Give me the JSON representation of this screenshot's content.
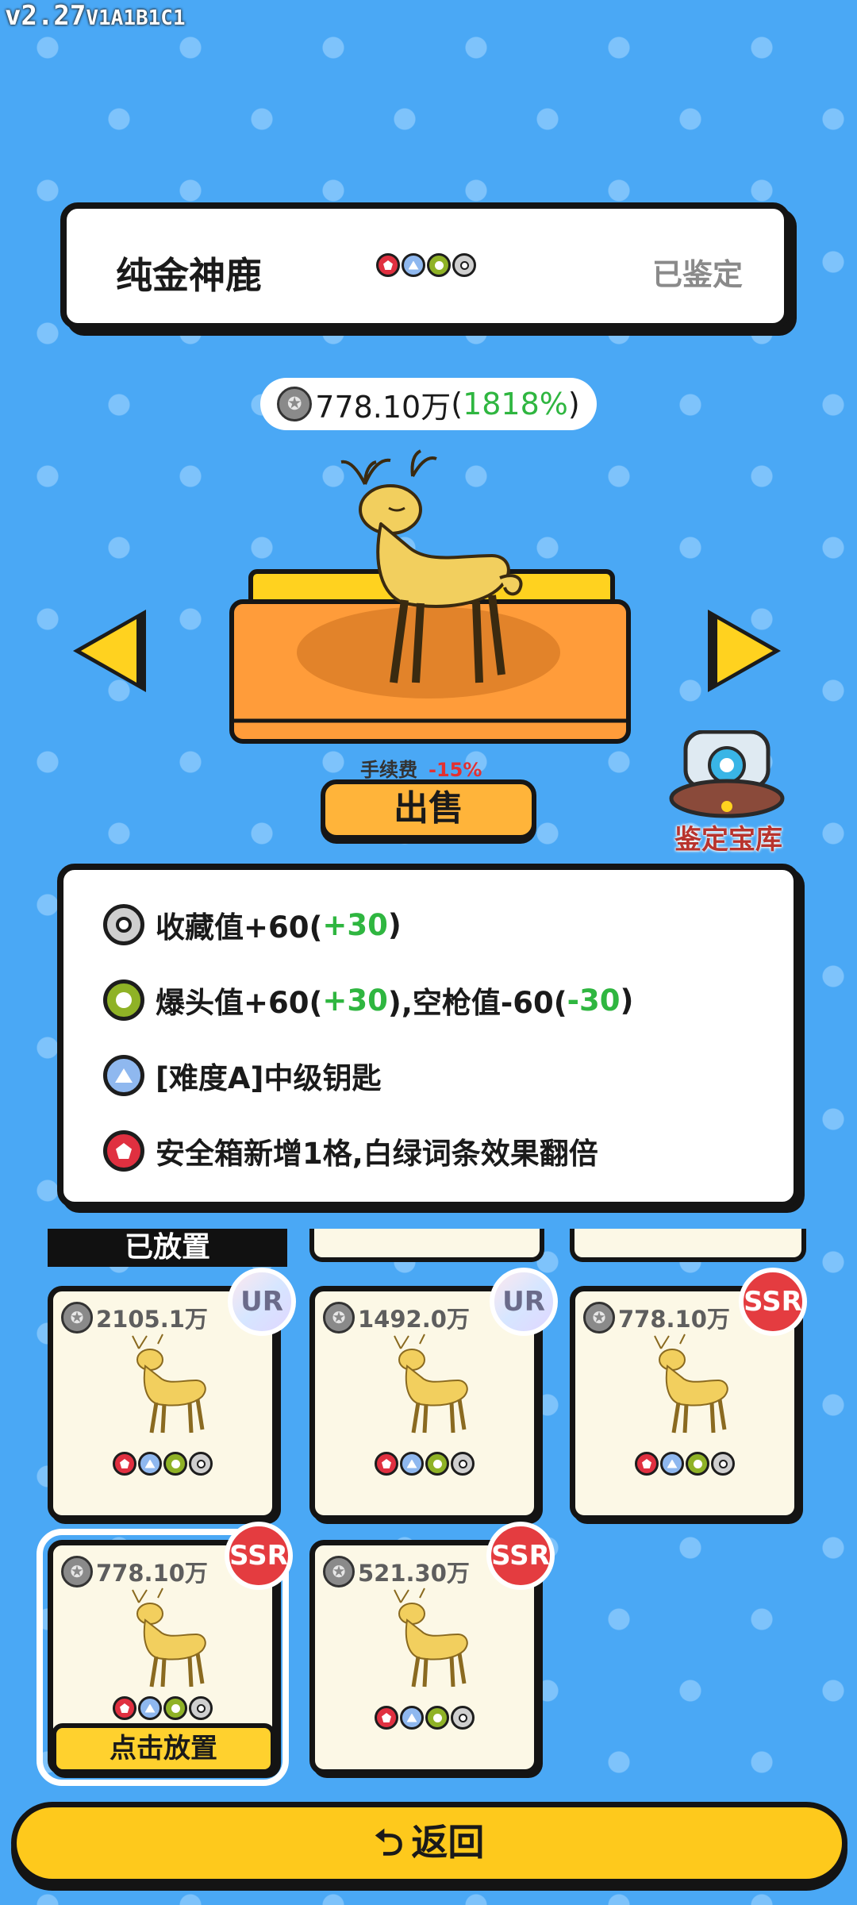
{
  "version": {
    "main": "v2.27",
    "suffix": "V1A1B1C1"
  },
  "item": {
    "name": "纯金神鹿",
    "status": "已鉴定",
    "gems": [
      "red",
      "blue",
      "green",
      "white"
    ],
    "price": "778.10万",
    "price_pct_open": "(",
    "price_pct": "1818%",
    "price_pct_close": ")"
  },
  "sell": {
    "fee_label": "手续费",
    "fee_pct": "-15%",
    "button": "出售"
  },
  "vault": {
    "label": "鉴定宝库"
  },
  "effects": [
    {
      "gem": "white",
      "a": "收藏值+60(",
      "b": "+30",
      "c": ")",
      "d": "",
      "e": "",
      "f": ""
    },
    {
      "gem": "green",
      "a": "爆头值+60(",
      "b": "+30",
      "c": "),空枪值-60(",
      "d": "-30",
      "e": ")",
      "f": ""
    },
    {
      "gem": "blue",
      "a": "[难度A]中级钥匙",
      "b": "",
      "c": "",
      "d": "",
      "e": "",
      "f": ""
    },
    {
      "gem": "red",
      "a": "安全箱新增1格,白绿词条效果翻倍",
      "b": "",
      "c": "",
      "d": "",
      "e": "",
      "f": ""
    }
  ],
  "placed": {
    "tab_label": "已放置"
  },
  "cards": [
    {
      "price": "2105.1万",
      "rarity": "UR",
      "gems": [
        "red",
        "blue",
        "green",
        "white"
      ]
    },
    {
      "price": "1492.0万",
      "rarity": "UR",
      "gems": [
        "red",
        "blue",
        "green",
        "white"
      ]
    },
    {
      "price": "778.10万",
      "rarity": "SSR",
      "gems": [
        "red",
        "blue",
        "green",
        "white"
      ]
    },
    {
      "price": "778.10万",
      "rarity": "SSR",
      "gems": [
        "red",
        "blue",
        "green",
        "white"
      ],
      "button": "点击放置"
    },
    {
      "price": "521.30万",
      "rarity": "SSR",
      "gems": [
        "red",
        "blue",
        "green",
        "white"
      ]
    }
  ],
  "back": {
    "label": "返回",
    "icon": "return-arrow-icon"
  },
  "colors": {
    "background": "#4aa8f5",
    "accent_yellow": "#fec91c",
    "green": "#2fb640",
    "red": "#e43030"
  }
}
